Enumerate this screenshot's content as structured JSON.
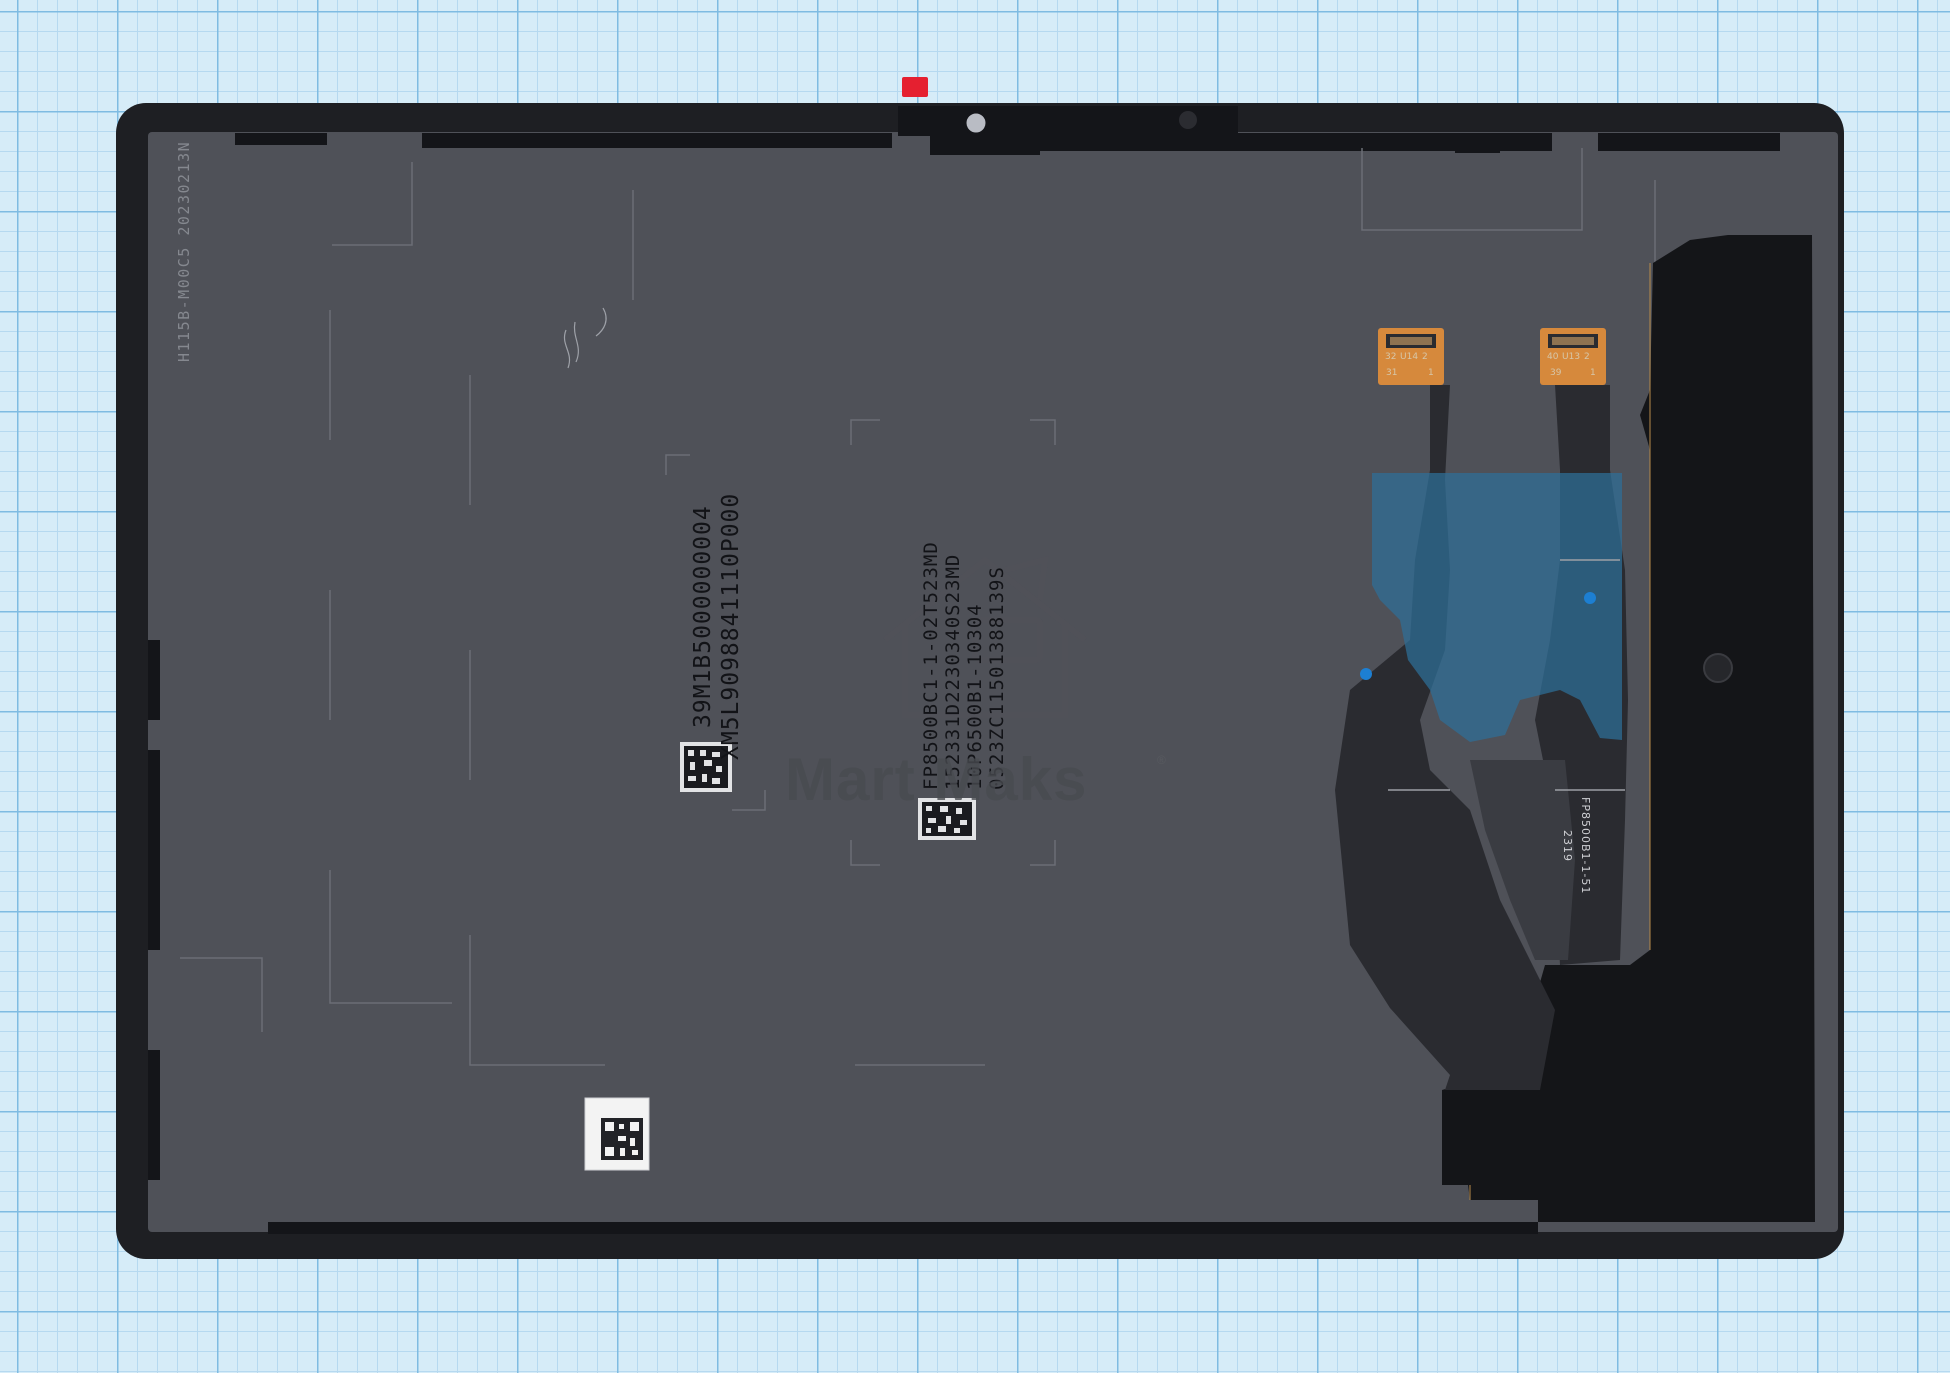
{
  "panel": {
    "vertical_code": "H115B-M00C5 20230213N",
    "serial_lines_left": [
      "39M1B5000000004",
      "XM5L9098841110P000"
    ],
    "serial_lines_center": [
      "FP8500BC1-1-02T523MD",
      "152331D2230340S23MD",
      "10P6500B1-10304",
      "0523ZC11501388139S"
    ]
  },
  "connectors": {
    "left_pins": {
      "top_left": "32",
      "top_mid": "U14",
      "top_right": "2",
      "bottom_left": "31",
      "bottom_right": "1"
    },
    "right_pins": {
      "top_left": "40",
      "top_mid": "U13",
      "top_right": "2",
      "bottom_left": "39",
      "bottom_right": "1"
    },
    "fpc_label": "FP8500B1-1-51",
    "fpc_date": "2319"
  },
  "watermark": {
    "text": "Mart Maks",
    "mark": "®"
  },
  "colors": {
    "grid_paper": "#d6ecf8",
    "bezel": "#1e1f23",
    "panel": "#4f5158",
    "cable": "#2a2b30",
    "connector": "#d6893c",
    "blue_tape": "#2e6f98",
    "red_tab": "#e52030"
  }
}
